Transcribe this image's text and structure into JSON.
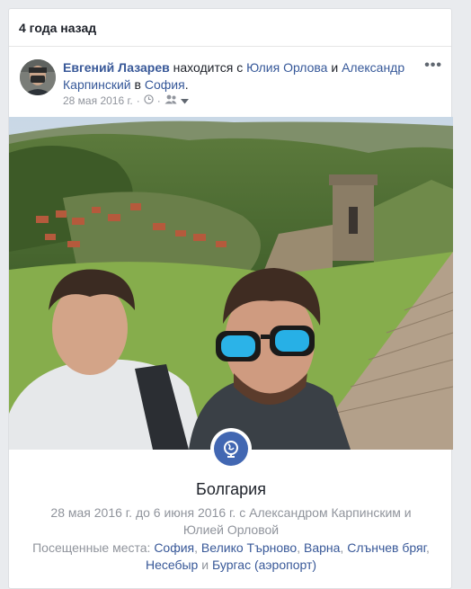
{
  "header": {
    "title": "4 года назад"
  },
  "post": {
    "author": "Евгений Лазарев",
    "at_text": " находится с ",
    "friend1": "Юлия Орлова",
    "and_text": " и ",
    "friend2": "Александр Карпинский",
    "in_text": " в ",
    "city": "София",
    "end": ".",
    "date": "28 мая 2016 г.",
    "sep": "·",
    "more": "•••",
    "icons": [
      "clock-icon",
      "friends-audience-icon",
      "caret-down-icon",
      "globe-icon"
    ]
  },
  "trip": {
    "title": "Болгария",
    "dates_line1": "28 мая 2016 г. до 6 июня 2016 г. с Александром Карпинским и",
    "dates_line2": "Юлией Орловой",
    "visited_label": "Посещенные места: ",
    "places": [
      "София",
      "Велико Търново",
      "Варна",
      "Слънчев бряг",
      "Несебыр",
      "Бургас (аэропорт)"
    ],
    "sep_comma": ", ",
    "sep_and": " и "
  },
  "colors": {
    "link": "#385898",
    "muted": "#90949c",
    "accent": "#4267b2"
  }
}
